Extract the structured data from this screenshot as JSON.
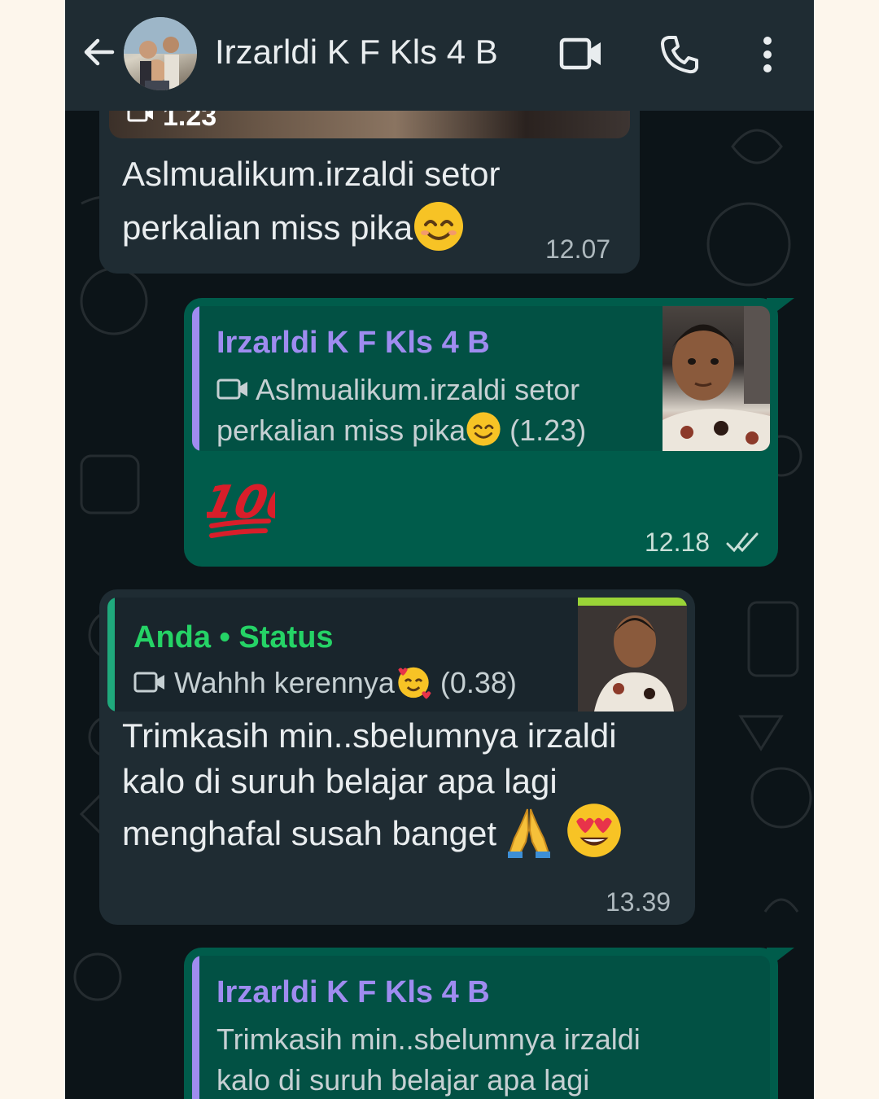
{
  "header": {
    "contact_name": "Irzarldi K F Kls 4 B",
    "icons": [
      "back-arrow-icon",
      "video-call-icon",
      "phone-call-icon",
      "more-vert-icon"
    ]
  },
  "messages": [
    {
      "direction": "incoming",
      "media_duration": "1.23",
      "line1": "Aslmualikum.irzaldi setor",
      "line2": "perkalian miss pika",
      "emoji": "smiling-face-icon",
      "time": "12.07"
    },
    {
      "direction": "outgoing",
      "quote": {
        "author": "Irzarldi K F Kls 4 B",
        "line1": "Aslmualikum.irzaldi setor",
        "line2": "perkalian miss pika",
        "duration": "(1.23)"
      },
      "emoji": "hundred-points-icon",
      "time": "12.18",
      "status": "read"
    },
    {
      "direction": "incoming",
      "quote": {
        "author": "Anda • Status",
        "text": "Wahhh kerennya",
        "duration": "(0.38)"
      },
      "line1": "Trimkasih min..sbelumnya irzaldi",
      "line2": "kalo di suruh belajar apa lagi",
      "line3": "menghafal susah banget",
      "time": "13.39"
    },
    {
      "direction": "outgoing",
      "quote": {
        "author": "Irzarldi K F Kls 4 B",
        "line1": "Trimkasih min..sbelumnya irzaldi",
        "line2": "kalo di suruh belajar apa lagi"
      }
    }
  ],
  "colors": {
    "header_bg": "#1f2c33",
    "chat_bg": "#0c1418",
    "incoming_bubble": "#1f2c33",
    "outgoing_bubble": "#005c4b",
    "quote_name_purple": "#9f8cf0",
    "quote_name_green": "#25d366"
  }
}
